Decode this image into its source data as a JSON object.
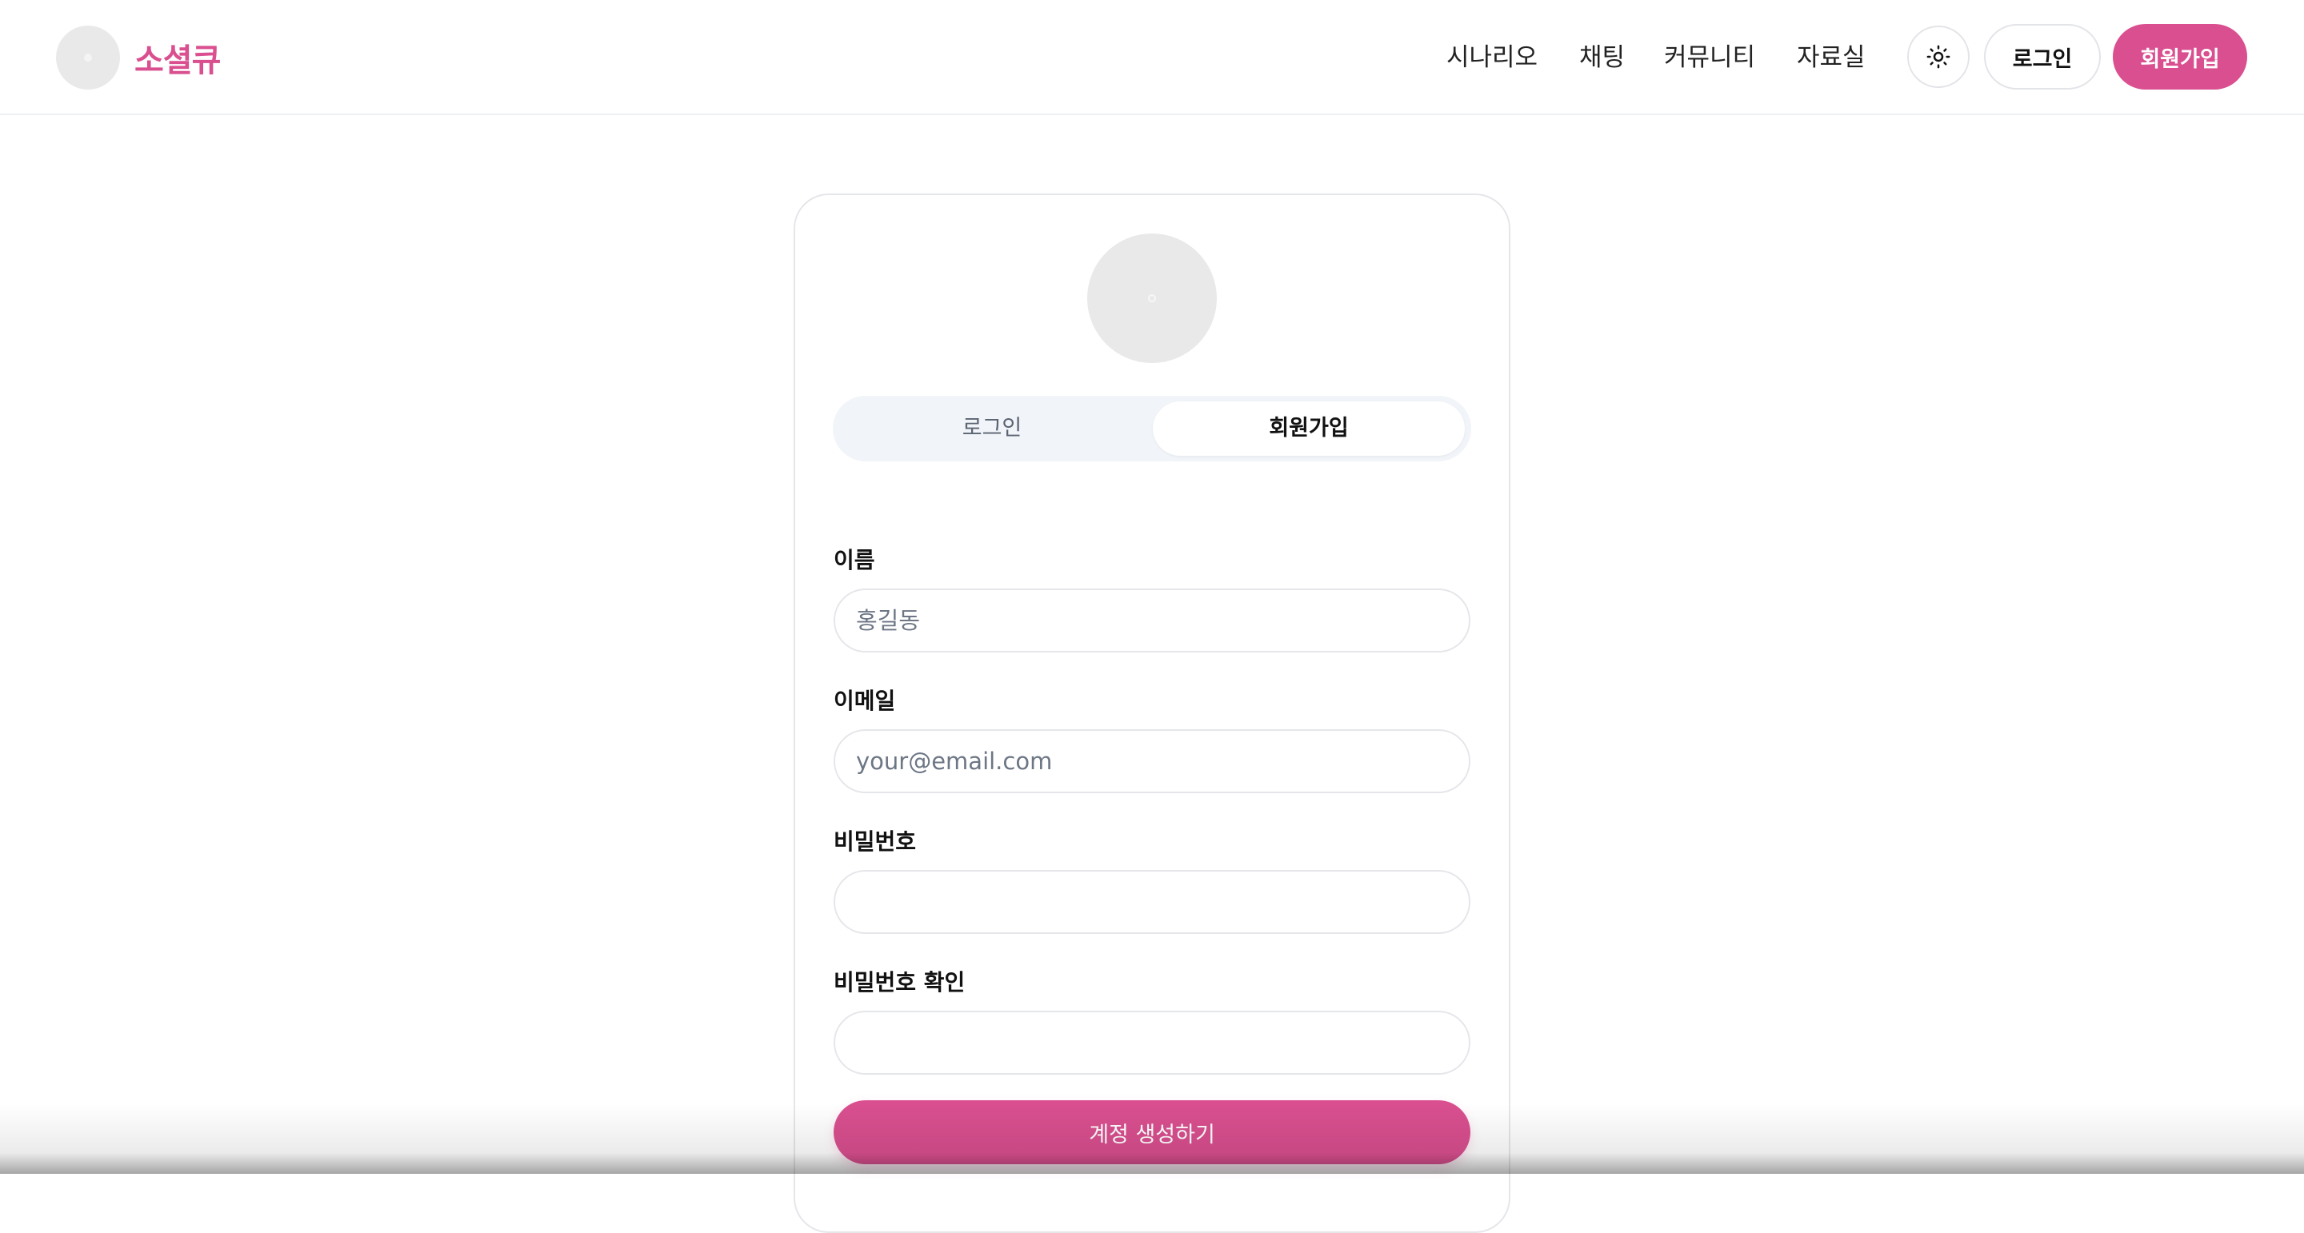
{
  "brand": {
    "name": "소셜큐"
  },
  "nav": {
    "items": [
      {
        "label": "시나리오"
      },
      {
        "label": "채팅"
      },
      {
        "label": "커뮤니티"
      },
      {
        "label": "자료실"
      }
    ]
  },
  "header": {
    "login_label": "로그인",
    "signup_label": "회원가입"
  },
  "auth": {
    "tabs": {
      "login": "로그인",
      "signup": "회원가입",
      "active": "회원가입"
    },
    "fields": {
      "name": {
        "label": "이름",
        "placeholder": "홍길동",
        "value": ""
      },
      "email": {
        "label": "이메일",
        "placeholder": "your@email.com",
        "value": ""
      },
      "password": {
        "label": "비밀번호",
        "placeholder": "",
        "value": ""
      },
      "password_confirm": {
        "label": "비밀번호 확인",
        "placeholder": "",
        "value": ""
      }
    },
    "submit_label": "계정 생성하기"
  },
  "colors": {
    "brand": "#d94f8f",
    "tab_track": "#f1f4f8",
    "border": "#e5e6ea"
  },
  "icons": {
    "theme_toggle": "sun-icon",
    "logo": "logo-placeholder-icon",
    "avatar": "avatar-placeholder-icon"
  }
}
